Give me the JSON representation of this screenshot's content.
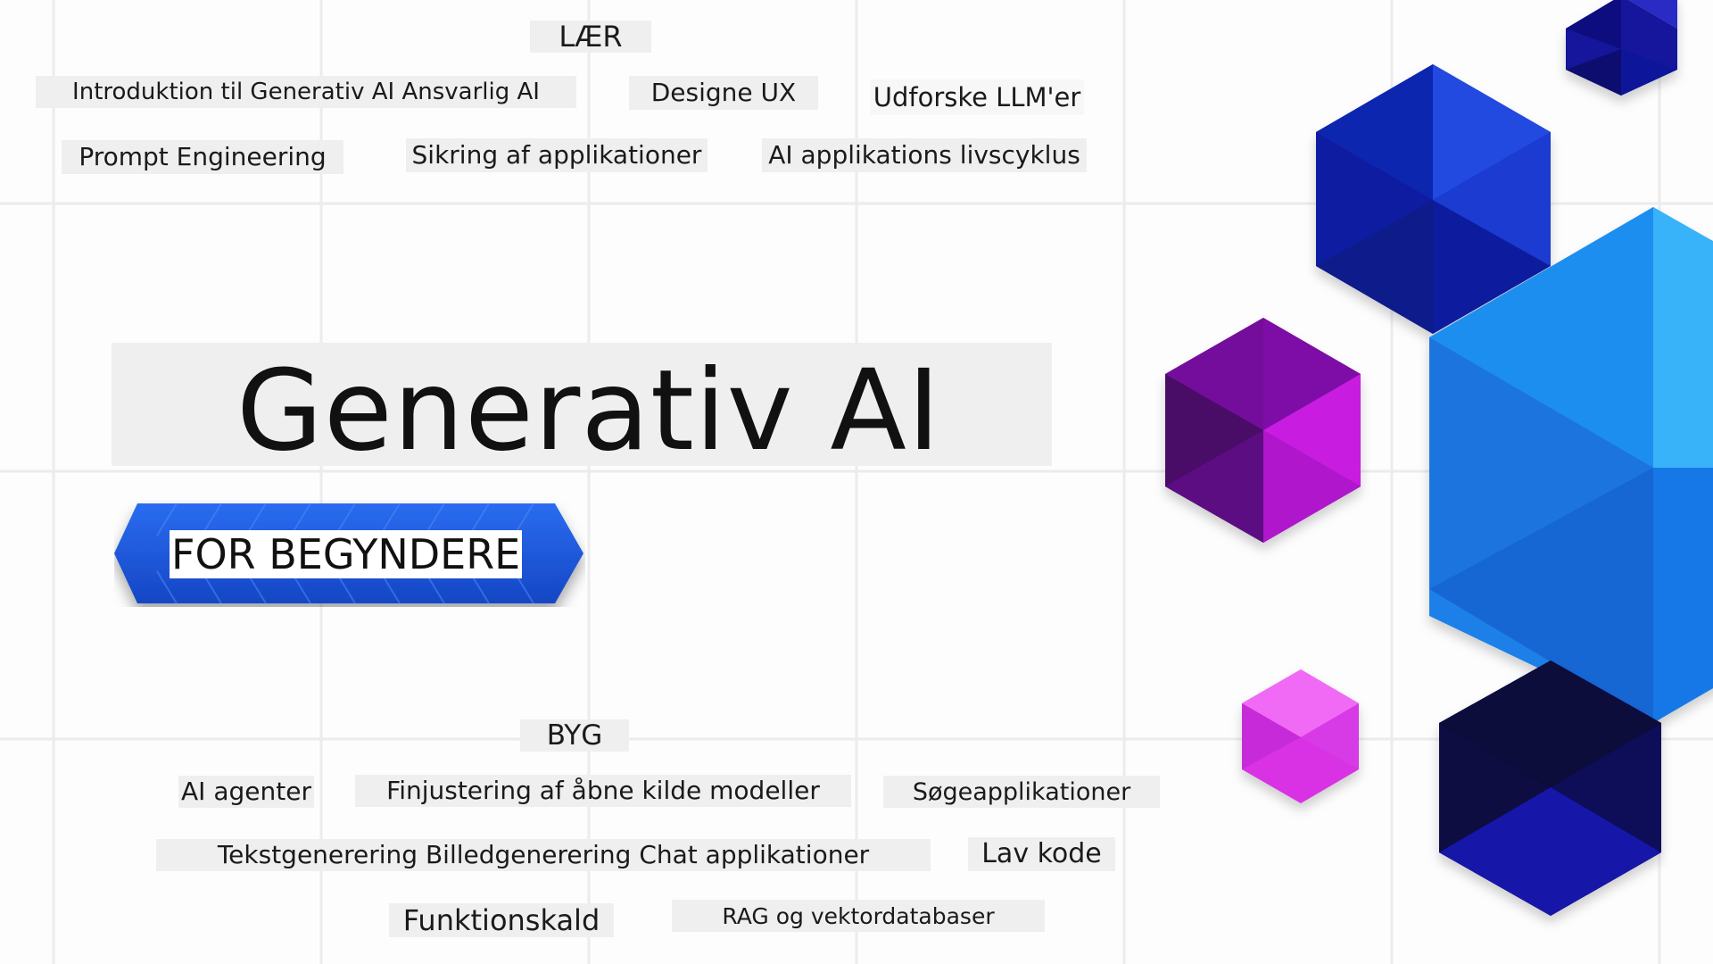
{
  "learn": {
    "heading": "LÆR",
    "topics": [
      "Introduktion til Generativ AI Ansvarlig AI",
      "Designe UX",
      "Udforske LLM'er",
      "Prompt Engineering",
      "Sikring af applikationer",
      "AI applikations livscyklus"
    ]
  },
  "hero": {
    "title": "Generativ AI",
    "subtitle": "FOR BEGYNDERE"
  },
  "build": {
    "heading": "BYG",
    "topics": [
      "AI agenter",
      "Finjustering af åbne kilde modeller",
      "Søgeapplikationer",
      "Tekstgenerering Billedgenerering Chat applikationer",
      "Lav kode",
      "Funktionskald",
      "RAG og vektordatabaser"
    ]
  },
  "colors": {
    "grid": "#ececec",
    "label_bg": "#efefef",
    "ribbon_blue": "#1f5ae0",
    "ribbon_dark": "#1443b8",
    "hex_blue": "#1a8cf0",
    "hex_navy": "#0d1fa8",
    "hex_dark": "#08083a",
    "hex_purple": "#7a0d9e",
    "hex_magenta": "#e03ce8"
  }
}
